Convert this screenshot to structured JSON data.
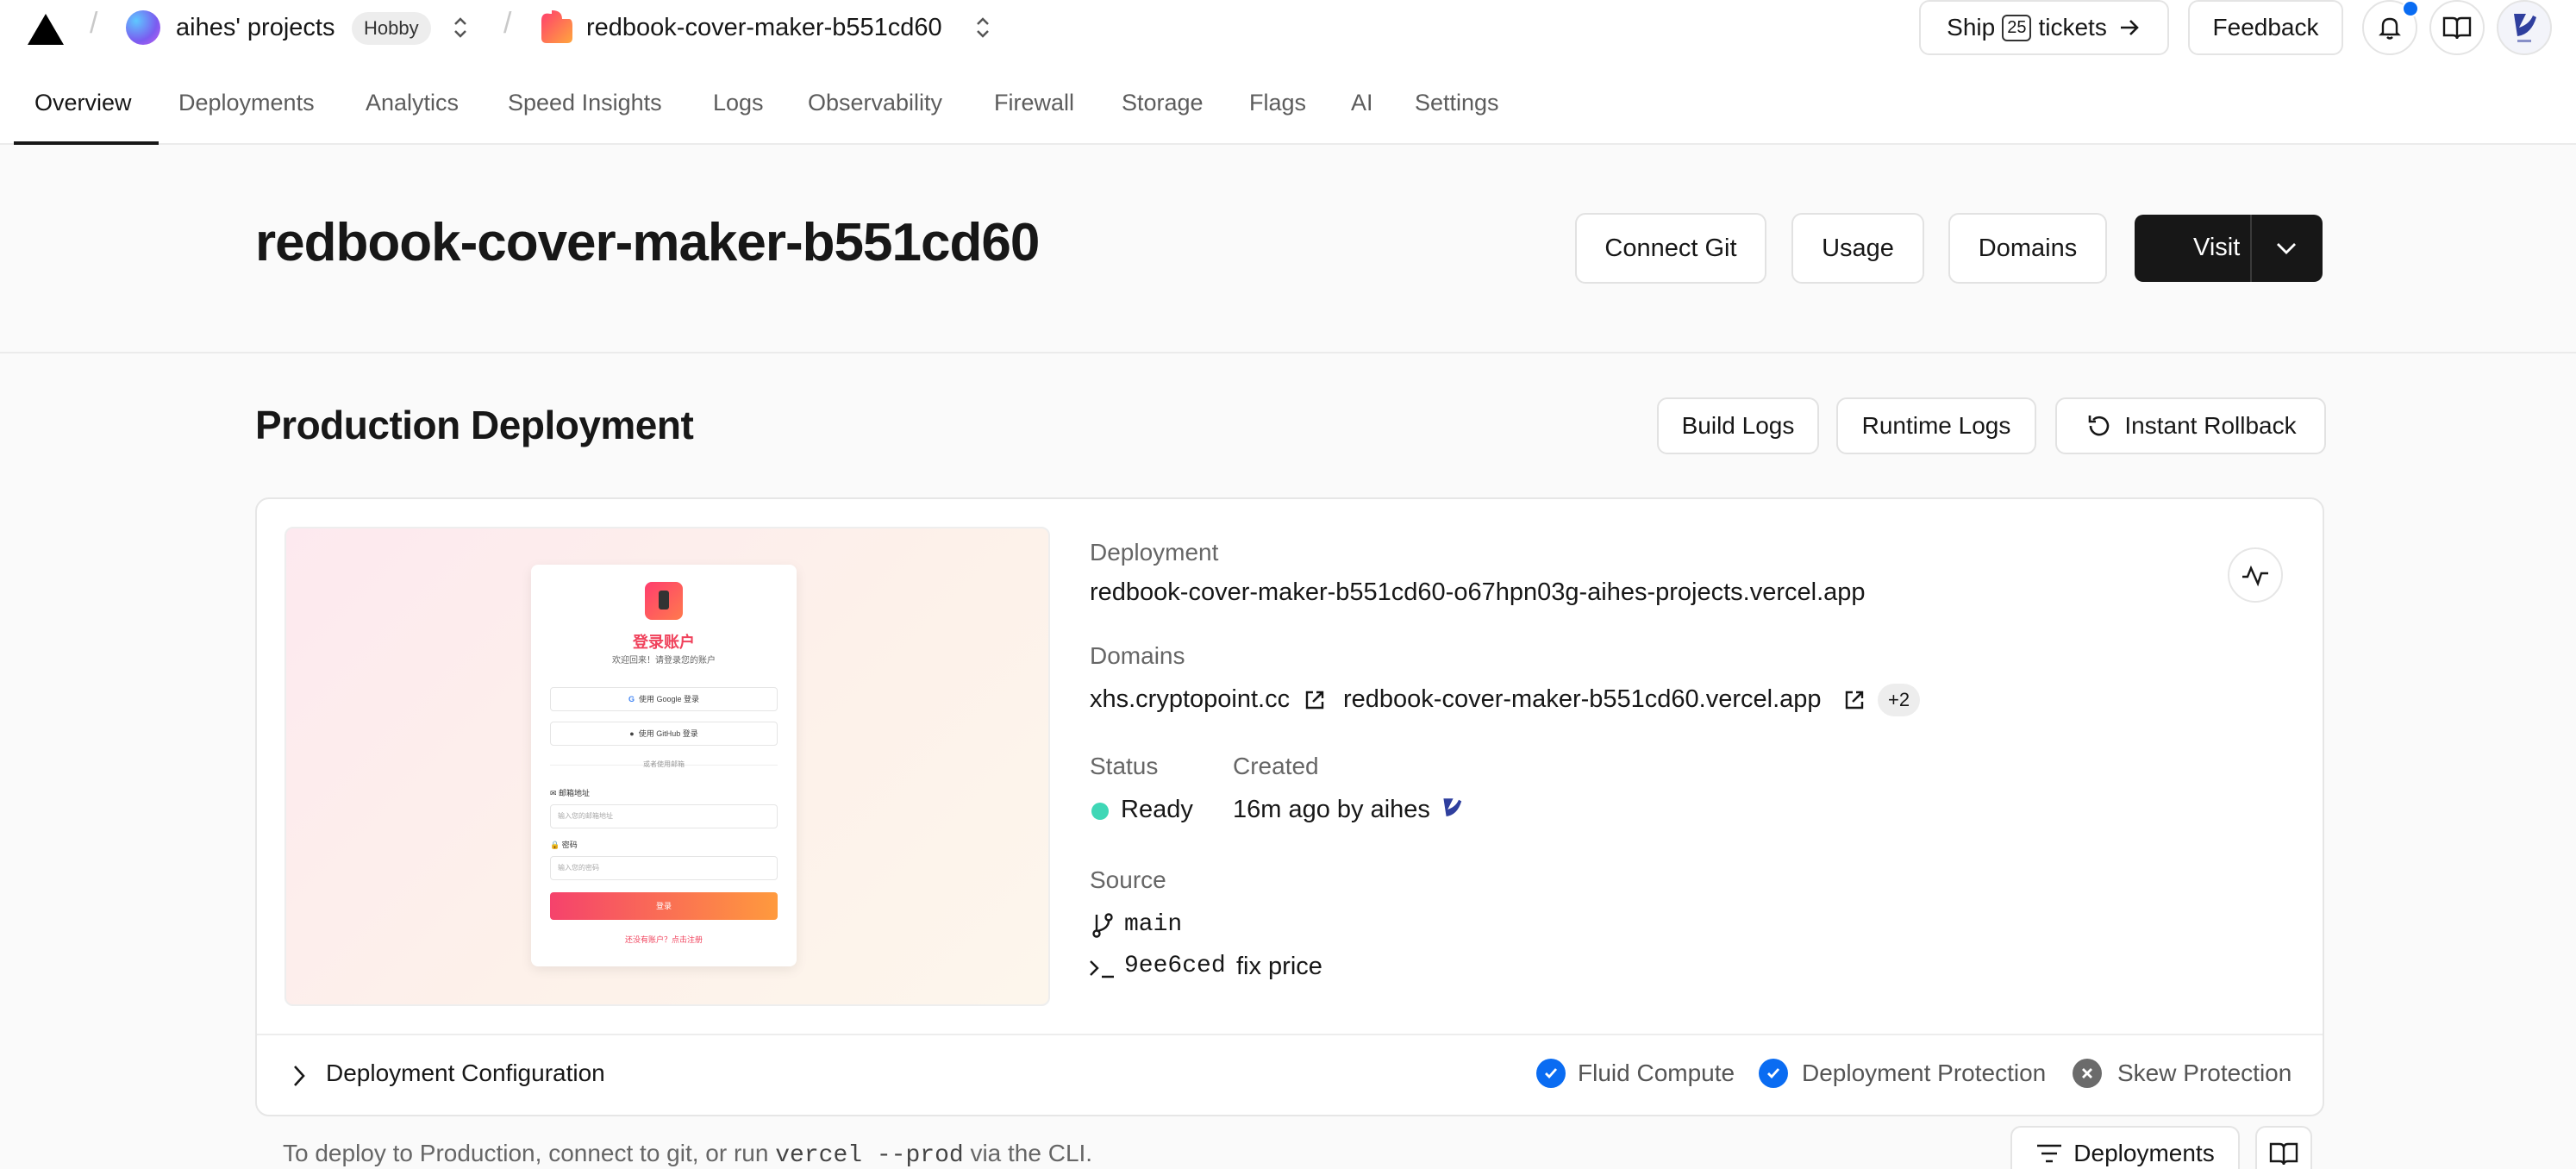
{
  "breadcrumb": {
    "team_name": "aihes' projects",
    "plan_badge": "Hobby",
    "project_name": "redbook-cover-maker-b551cd60"
  },
  "top_actions": {
    "ship_prefix": "Ship",
    "ship_count": "25",
    "ship_suffix": "tickets",
    "feedback": "Feedback"
  },
  "tabs": [
    {
      "label": "Overview",
      "active": true
    },
    {
      "label": "Deployments"
    },
    {
      "label": "Analytics"
    },
    {
      "label": "Speed Insights"
    },
    {
      "label": "Logs"
    },
    {
      "label": "Observability"
    },
    {
      "label": "Firewall"
    },
    {
      "label": "Storage"
    },
    {
      "label": "Flags"
    },
    {
      "label": "AI"
    },
    {
      "label": "Settings"
    }
  ],
  "project": {
    "title": "redbook-cover-maker-b551cd60",
    "actions": {
      "connect_git": "Connect Git",
      "usage": "Usage",
      "domains": "Domains",
      "visit": "Visit"
    }
  },
  "production": {
    "title": "Production Deployment",
    "actions": {
      "build_logs": "Build Logs",
      "runtime_logs": "Runtime Logs",
      "instant_rollback": "Instant Rollback"
    }
  },
  "deployment": {
    "deployment_label": "Deployment",
    "deployment_url": "redbook-cover-maker-b551cd60-o67hpn03g-aihes-projects.vercel.app",
    "domains_label": "Domains",
    "domain_1": "xhs.cryptopoint.cc",
    "domain_2": "redbook-cover-maker-b551cd60.vercel.app",
    "domains_more": "+2",
    "status_label": "Status",
    "status_value": "Ready",
    "created_label": "Created",
    "created_value": "16m ago by aihes",
    "source_label": "Source",
    "branch": "main",
    "commit_hash": "9ee6ced",
    "commit_message": "fix price"
  },
  "preview": {
    "title": "登录账户",
    "subtitle": "欢迎回来！请登录您的账户",
    "google": "使用 Google 登录",
    "github": "使用 GitHub 登录",
    "divider": "或者使用邮箱",
    "email_label": "邮箱地址",
    "email_placeholder": "输入您的邮箱地址",
    "password_label": "密码",
    "password_placeholder": "输入您的密码",
    "login_button": "登录",
    "register_link": "还没有账户？点击注册"
  },
  "config": {
    "label": "Deployment Configuration",
    "features": [
      {
        "label": "Fluid Compute",
        "enabled": true
      },
      {
        "label": "Deployment Protection",
        "enabled": true
      },
      {
        "label": "Skew Protection",
        "enabled": false
      }
    ]
  },
  "footer": {
    "note_prefix": "To deploy to Production, connect to git, or run",
    "note_command": "vercel --prod",
    "note_suffix": "via the CLI.",
    "deployments_button": "Deployments"
  },
  "colors": {
    "accent": "#0a6cf2",
    "ready": "#3fd7b6",
    "dark": "#171717",
    "notification": "#0a6cf2"
  }
}
